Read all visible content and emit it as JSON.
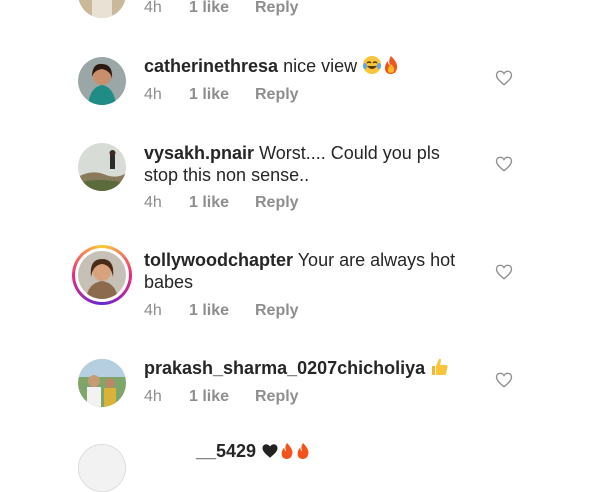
{
  "comments": [
    {
      "username": "",
      "text": "",
      "time": "4h",
      "likes": "1 like",
      "reply": "Reply"
    },
    {
      "username": "catherinethresa",
      "text": "nice view",
      "emojis": [
        "joy-emoji",
        "fire-emoji"
      ],
      "time": "4h",
      "likes": "1 like",
      "reply": "Reply"
    },
    {
      "username": "vysakh.pnair",
      "text": "Worst.... Could you pls stop this non sense..",
      "time": "4h",
      "likes": "1 like",
      "reply": "Reply"
    },
    {
      "username": "tollywoodchapter",
      "text": "Your are always hot babes",
      "time": "4h",
      "likes": "1 like",
      "reply": "Reply"
    },
    {
      "username": "prakash_sharma_0207chicholiya",
      "text": "",
      "emojis": [
        "thumbs-up-emoji"
      ],
      "time": "4h",
      "likes": "1 like",
      "reply": "Reply"
    },
    {
      "username": "__5429",
      "text": "",
      "emojis": [
        "black-heart-emoji",
        "fire-emoji",
        "fire-emoji"
      ]
    }
  ],
  "colors": {
    "text": "#262626",
    "meta": "#8e8e8e",
    "heart": "#8e8e8e",
    "story_ring_start": "#f9ce34",
    "story_ring_mid": "#ee2a7b",
    "story_ring_end": "#6228d7"
  }
}
